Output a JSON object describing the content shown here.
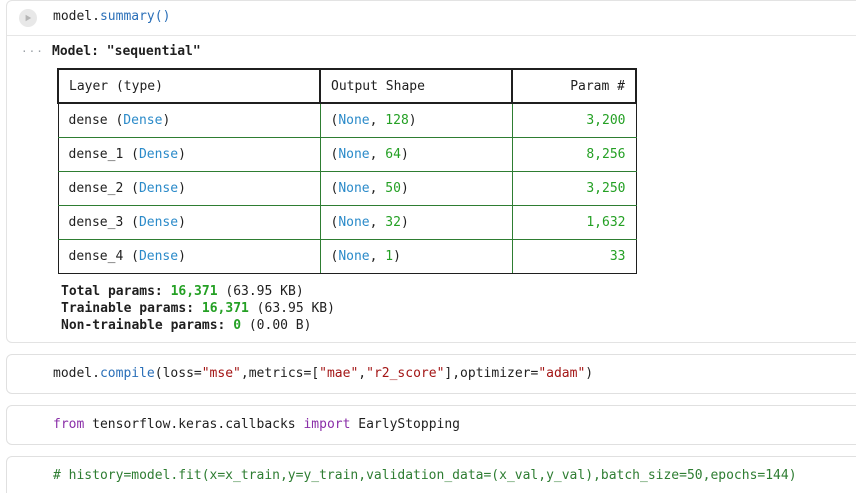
{
  "cell1": {
    "code": {
      "obj": "model",
      "dot": ".",
      "method": "summary",
      "paren_open": "(",
      "paren_close": ")"
    },
    "output": {
      "ellipsis": "···",
      "model_title": "Model: \"sequential\"",
      "table": {
        "headers": [
          "Layer (type)",
          "Output Shape",
          "Param #"
        ],
        "rows": [
          {
            "layer": "dense",
            "type": "Dense",
            "none": "None",
            "dim": "128",
            "params": "3,200"
          },
          {
            "layer": "dense_1",
            "type": "Dense",
            "none": "None",
            "dim": "64",
            "params": "8,256"
          },
          {
            "layer": "dense_2",
            "type": "Dense",
            "none": "None",
            "dim": "50",
            "params": "3,250"
          },
          {
            "layer": "dense_3",
            "type": "Dense",
            "none": "None",
            "dim": "32",
            "params": "1,632"
          },
          {
            "layer": "dense_4",
            "type": "Dense",
            "none": "None",
            "dim": "1",
            "params": "33"
          }
        ]
      },
      "totals": {
        "total_label": "Total params: ",
        "total_value": "16,371",
        "total_size": " (63.95 KB)",
        "trainable_label": "Trainable params: ",
        "trainable_value": "16,371",
        "trainable_size": " (63.95 KB)",
        "nontrainable_label": "Non-trainable params: ",
        "nontrainable_value": "0",
        "nontrainable_size": " (0.00 B)"
      }
    }
  },
  "cell2": {
    "code": {
      "prefix": "model.",
      "method": "compile",
      "args_1": "(loss=",
      "loss": "\"mse\"",
      "args_2": ",metrics=[",
      "m1": "\"mae\"",
      "comma": ",",
      "m2": "\"r2_score\"",
      "args_3": "],optimizer=",
      "opt": "\"adam\"",
      "args_4": ")"
    }
  },
  "cell3": {
    "code": {
      "kw_from": "from",
      "module": " tensorflow.keras.callbacks ",
      "kw_import": "import",
      "name": " EarlyStopping"
    }
  },
  "cell4": {
    "code": {
      "comment": "# history=model.fit(x=x_train,y=y_train,validation_data=(x_val,y_val),batch_size=50,epochs=144)"
    }
  },
  "colors": {
    "keyword_purple": "#8a2ea8",
    "number_green": "#24a024",
    "type_blue": "#2a8ac9",
    "string_red": "#a31515",
    "comment_green": "#2e7d32"
  },
  "icons": {
    "run": "play-icon",
    "output_menu": "ellipsis-icon"
  }
}
